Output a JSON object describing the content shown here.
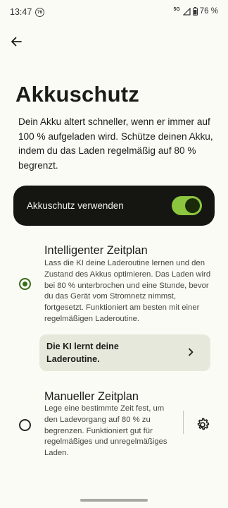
{
  "status": {
    "time": "13:47",
    "badge": "76",
    "network": "5G",
    "battery": "76 %"
  },
  "header": {
    "back_icon": "arrow-left-icon"
  },
  "page": {
    "title": "Akkuschutz",
    "description": "Dein Akku altert schneller, wenn er immer auf 100 % aufgeladen wird. Schütze deinen Akku, indem du das Laden regelmäßig auf 80 % begrenzt."
  },
  "toggle": {
    "label": "Akkuschutz verwenden",
    "on": true,
    "color": "#8cc63f"
  },
  "options": [
    {
      "title": "Intelligenter Zeitplan",
      "description": "Lass die KI deine Laderoutine lernen und den Zustand des Akkus optimieren. Das Laden wird bei 80 % unterbrochen und eine Stunde, bevor du das Gerät vom Stromnetz nimmst, fortgesetzt. Funktioniert am besten mit einer regelmäßigen Laderoutine.",
      "selected": true
    },
    {
      "title": "Manueller Zeitplan",
      "description": "Lege eine bestimmte Zeit fest, um den Ladevorgang auf 80 % zu begrenzen. Funktioniert gut für regelmäßiges und unregelmäßiges Laden.",
      "selected": false
    }
  ],
  "info_card": {
    "text": "Die KI lernt deine Laderoutine."
  }
}
